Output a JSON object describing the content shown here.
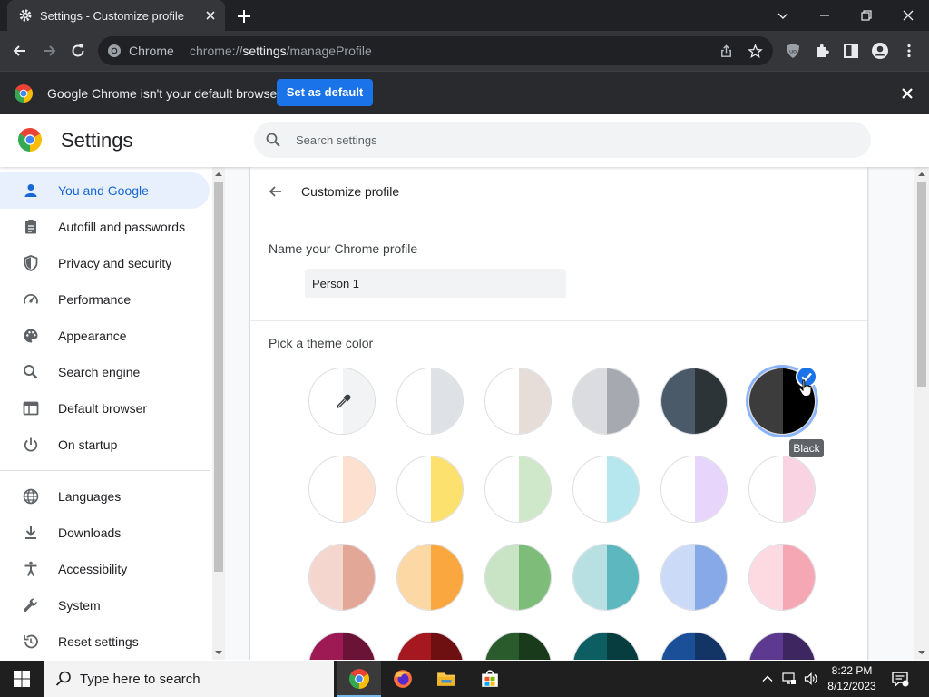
{
  "browser": {
    "tab_title": "Settings - Customize profile",
    "omnibox": {
      "site_name": "Chrome",
      "url_scheme": "chrome://",
      "url_host": "settings",
      "url_path": "/manageProfile"
    }
  },
  "infobar": {
    "message": "Google Chrome isn't your default browser",
    "button_label": "Set as default"
  },
  "settings": {
    "title": "Settings",
    "search_placeholder": "Search settings",
    "nav": [
      {
        "label": "You and Google",
        "icon": "person-icon",
        "active": true
      },
      {
        "label": "Autofill and passwords",
        "icon": "clipboard-icon"
      },
      {
        "label": "Privacy and security",
        "icon": "shield-icon"
      },
      {
        "label": "Performance",
        "icon": "speedometer-icon"
      },
      {
        "label": "Appearance",
        "icon": "palette-icon"
      },
      {
        "label": "Search engine",
        "icon": "search-icon"
      },
      {
        "label": "Default browser",
        "icon": "browser-window-icon"
      },
      {
        "label": "On startup",
        "icon": "power-icon"
      },
      {
        "label": "Languages",
        "icon": "globe-icon"
      },
      {
        "label": "Downloads",
        "icon": "download-icon"
      },
      {
        "label": "Accessibility",
        "icon": "accessibility-icon"
      },
      {
        "label": "System",
        "icon": "wrench-icon"
      },
      {
        "label": "Reset settings",
        "icon": "reset-icon"
      }
    ]
  },
  "customize": {
    "title": "Customize profile",
    "name_label": "Name your Chrome profile",
    "profile_name": "Person 1",
    "theme_label": "Pick a theme color",
    "selected_tooltip": "Black",
    "colors": [
      [
        {
          "l": "#ffffff",
          "r": "#f1f3f4",
          "picker": true
        },
        {
          "l": "#ffffff",
          "r": "#dee1e6"
        },
        {
          "l": "#ffffff",
          "r": "#e6ddd9"
        },
        {
          "l": "#dadce0",
          "r": "#a6a9b0"
        },
        {
          "l": "#4a5a68",
          "r": "#2d3438"
        },
        {
          "l": "#3c3c3c",
          "r": "#000000",
          "selected": true
        }
      ],
      [
        {
          "l": "#ffffff",
          "r": "#fde0d0"
        },
        {
          "l": "#ffffff",
          "r": "#fde16f"
        },
        {
          "l": "#ffffff",
          "r": "#cfe8c9"
        },
        {
          "l": "#ffffff",
          "r": "#b7e7ee"
        },
        {
          "l": "#ffffff",
          "r": "#e7d5fb"
        },
        {
          "l": "#ffffff",
          "r": "#f9d3e2"
        }
      ],
      [
        {
          "l": "#f5d6cf",
          "r": "#e3a797"
        },
        {
          "l": "#fcd8a5",
          "r": "#fba73f"
        },
        {
          "l": "#c8e4c5",
          "r": "#7ebc7a"
        },
        {
          "l": "#b8e0e3",
          "r": "#5db7be"
        },
        {
          "l": "#cbdaf7",
          "r": "#87a9e8"
        },
        {
          "l": "#fdd9e2",
          "r": "#f6a7b4"
        }
      ],
      [
        {
          "l": "#9e1a55",
          "r": "#6a1336"
        },
        {
          "l": "#a5181f",
          "r": "#6e0f12"
        },
        {
          "l": "#2a5b2d",
          "r": "#1a3a1c"
        },
        {
          "l": "#0d5e63",
          "r": "#083d40"
        },
        {
          "l": "#1b4f98",
          "r": "#123566"
        },
        {
          "l": "#5d3a8f",
          "r": "#3e2760"
        }
      ]
    ]
  },
  "taskbar": {
    "search_placeholder": "Type here to search",
    "time": "8:22 PM",
    "date": "8/12/2023"
  }
}
